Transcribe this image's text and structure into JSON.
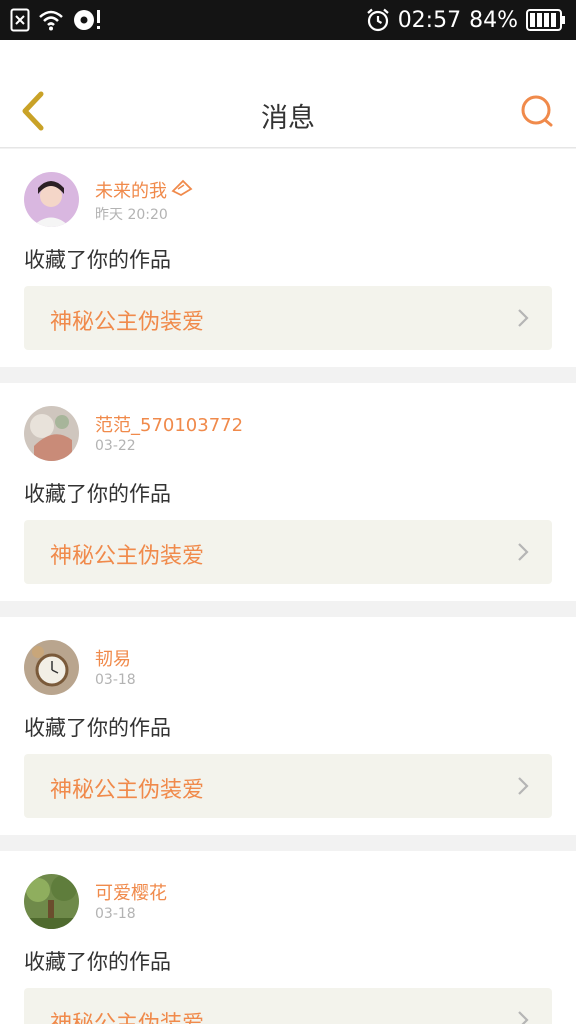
{
  "status_bar": {
    "time": "02:57",
    "battery": "84%"
  },
  "header": {
    "title": "消息"
  },
  "messages": [
    {
      "user": "未来的我",
      "time": "昨天 20:20",
      "action": "收藏了你的作品",
      "work_title": "神秘公主伪装爱"
    },
    {
      "user": "范范_570103772",
      "time": "03-22",
      "action": "收藏了你的作品",
      "work_title": "神秘公主伪装爱"
    },
    {
      "user": "韧易",
      "time": "03-18",
      "action": "收藏了你的作品",
      "work_title": "神秘公主伪装爱"
    },
    {
      "user": "可爱樱花",
      "time": "03-18",
      "action": "收藏了你的作品",
      "work_title": "神秘公主伪装爱"
    }
  ],
  "colors": {
    "accent": "#f08a4b",
    "back_arrow": "#c9a227",
    "card_link_bg": "#f3f3ec"
  },
  "icons": [
    "sim-off-icon",
    "wifi-icon",
    "hotspot-icon",
    "alarm-icon",
    "battery-icon",
    "back-arrow-icon",
    "search-icon",
    "vip-badge-icon",
    "chevron-right-icon"
  ]
}
